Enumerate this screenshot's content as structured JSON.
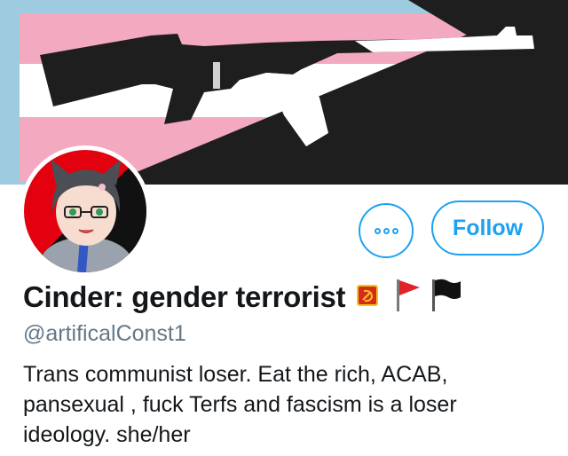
{
  "profile": {
    "display_name": "Cinder: gender terrorist",
    "handle": "@artificalConst1",
    "bio_lines": [
      "Trans communist loser. Eat the rich, ACAB,",
      "pansexual , fuck Terfs and fascism is a loser",
      "ideology. she/her"
    ],
    "name_emojis": [
      "hammer-and-sickle-icon",
      "red-flag-icon",
      "black-flag-icon"
    ]
  },
  "actions": {
    "more_icon": "more-options-icon",
    "follow_label": "Follow"
  },
  "colors": {
    "accent": "#1da1f2",
    "trans_blue": "#9ecbe0",
    "trans_pink": "#f3a9bf",
    "trans_white": "#ffffff",
    "banner_black": "#1e1e1e",
    "avatar_red": "#e3000f"
  }
}
